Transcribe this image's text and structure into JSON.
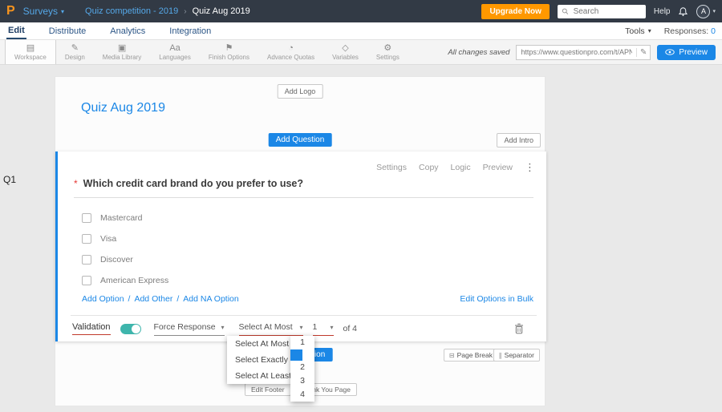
{
  "colors": {
    "accent": "#1b87e6",
    "topbar_bg": "#323a45",
    "upgrade_orange": "#ff9800",
    "toggle_teal": "#3eb5ac",
    "validation_red": "#c0392b"
  },
  "topbar": {
    "logo_letter": "P",
    "product_label": "Surveys",
    "breadcrumb_parent": "Quiz competition - 2019",
    "breadcrumb_separator": "›",
    "breadcrumb_current": "Quiz Aug 2019",
    "upgrade_label": "Upgrade Now",
    "search_placeholder": "Search",
    "help_label": "Help",
    "avatar_initial": "A"
  },
  "nav": {
    "items": [
      {
        "label": "Edit"
      },
      {
        "label": "Distribute"
      },
      {
        "label": "Analytics"
      },
      {
        "label": "Integration"
      }
    ],
    "tools_label": "Tools",
    "responses_label": "Responses:",
    "responses_count": "0"
  },
  "toolbar": {
    "items": [
      {
        "label": "Workspace",
        "icon": "▤"
      },
      {
        "label": "Design",
        "icon": "✎"
      },
      {
        "label": "Media Library",
        "icon": "▣"
      },
      {
        "label": "Languages",
        "icon": "Aa"
      },
      {
        "label": "Finish Options",
        "icon": "⚑"
      },
      {
        "label": "Advance Quotas",
        "icon": "◔"
      },
      {
        "label": "Variables",
        "icon": "◇"
      },
      {
        "label": "Settings",
        "icon": "⚙"
      }
    ],
    "saved_status": "All changes saved",
    "survey_url": "https://www.questionpro.com/t/APNrFZ",
    "preview_label": "Preview"
  },
  "editor": {
    "question_number": "Q1",
    "add_logo_label": "Add Logo",
    "survey_title": "Quiz Aug 2019",
    "add_question_label": "Add Question",
    "add_intro_label": "Add Intro",
    "question": {
      "actions": [
        "Settings",
        "Copy",
        "Logic",
        "Preview"
      ],
      "menu_icon": "⋮",
      "required_marker": "*",
      "text": "Which credit card brand do you prefer to use?",
      "options": [
        "Mastercard",
        "Visa",
        "Discover",
        "American Express"
      ],
      "add_links": [
        "Add Option",
        "Add Other",
        "Add NA Option"
      ],
      "links_separator": "/",
      "bulk_edit_label": "Edit Options in Bulk",
      "validation_label": "Validation",
      "force_response_label": "Force Response",
      "rule_value": "Select At Most",
      "count_value": "1",
      "of_label": "of 4"
    },
    "rule_dropdown": {
      "options": [
        "Select At Most",
        "Select Exactly",
        "Select At Least"
      ]
    },
    "count_dropdown": {
      "options": [
        "1",
        "2",
        "3",
        "4"
      ]
    },
    "page_break_label": "Page Break",
    "separator_label": "Separator",
    "edit_footer_label": "Edit Footer",
    "thank_you_label": "Thank You Page"
  }
}
